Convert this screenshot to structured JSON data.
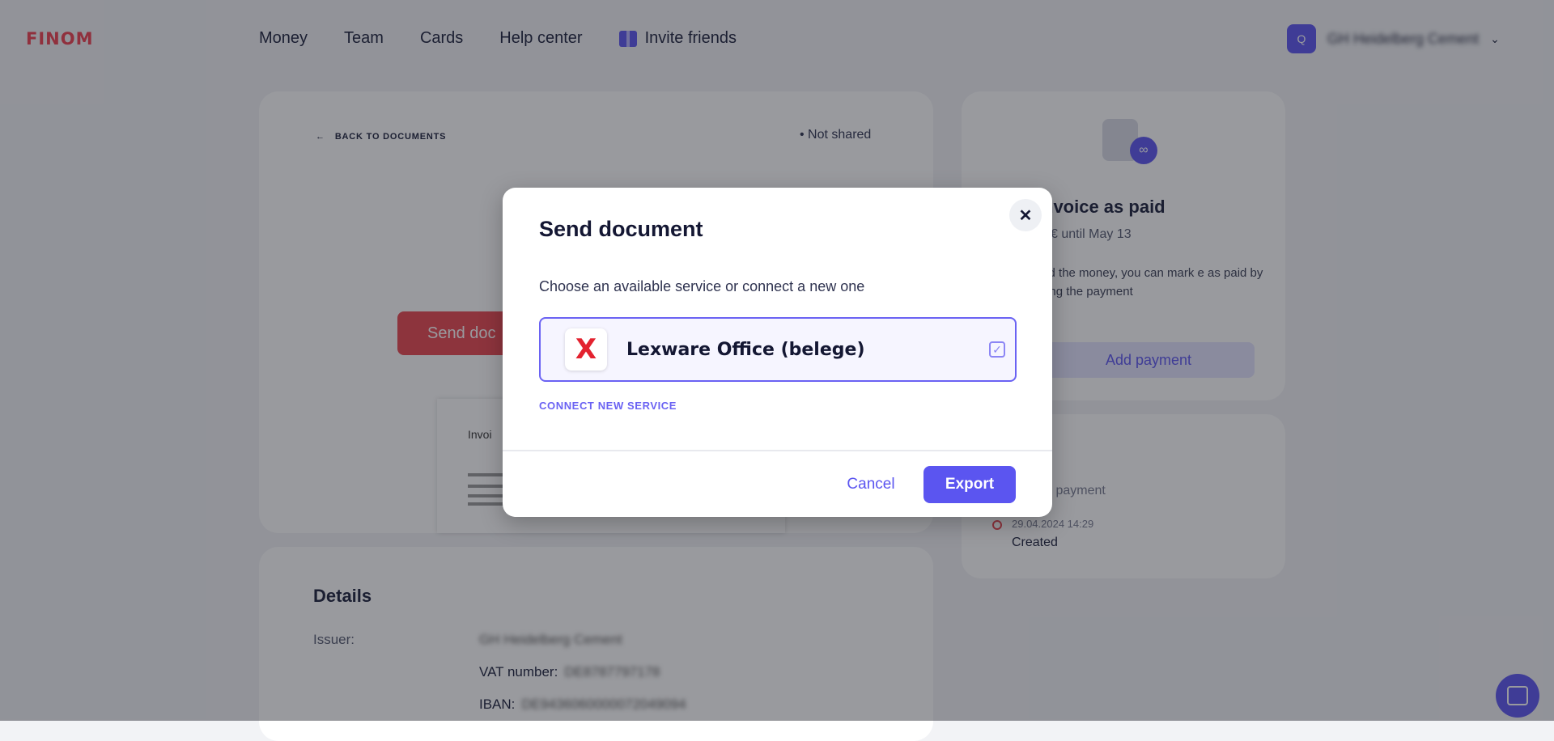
{
  "nav": {
    "logo": "FINOM",
    "links": [
      "Money",
      "Team",
      "Cards",
      "Help center"
    ],
    "invite": "Invite friends",
    "user_initial": "Q",
    "user_name": "GH Heidelberg Cement"
  },
  "document": {
    "back_label": "BACK TO DOCUMENTS",
    "share_status": "• Not shared",
    "send_button": "Send doc",
    "preview_title": "Invoi"
  },
  "details": {
    "title": "Details",
    "issuer_label": "Issuer:",
    "issuer_value": "GH Heidelberg Cement",
    "vat_label": "VAT number:",
    "vat_value": "DE8787797178",
    "iban_label": "IBAN:",
    "iban_value": "DE9436060000072049094"
  },
  "paid_card": {
    "title": "nvoice as paid",
    "subtitle": "€ until May 13",
    "text": "eived the money, you can mark e as paid by adding the payment",
    "button": "Add payment"
  },
  "history": {
    "waiting": "g for payment",
    "date": "29.04.2024 14:29",
    "status": "Created"
  },
  "modal": {
    "title": "Send document",
    "close_symbol": "✕",
    "subtitle": "Choose an available service or connect a new one",
    "service": {
      "logo": "X",
      "name": "Lexware Office (belege)",
      "check": "✓"
    },
    "connect_link": "CONNECT NEW SERVICE",
    "cancel": "Cancel",
    "export": "Export"
  },
  "colors": {
    "accent": "#5b55f0",
    "brand_red": "#ee3f4f"
  }
}
